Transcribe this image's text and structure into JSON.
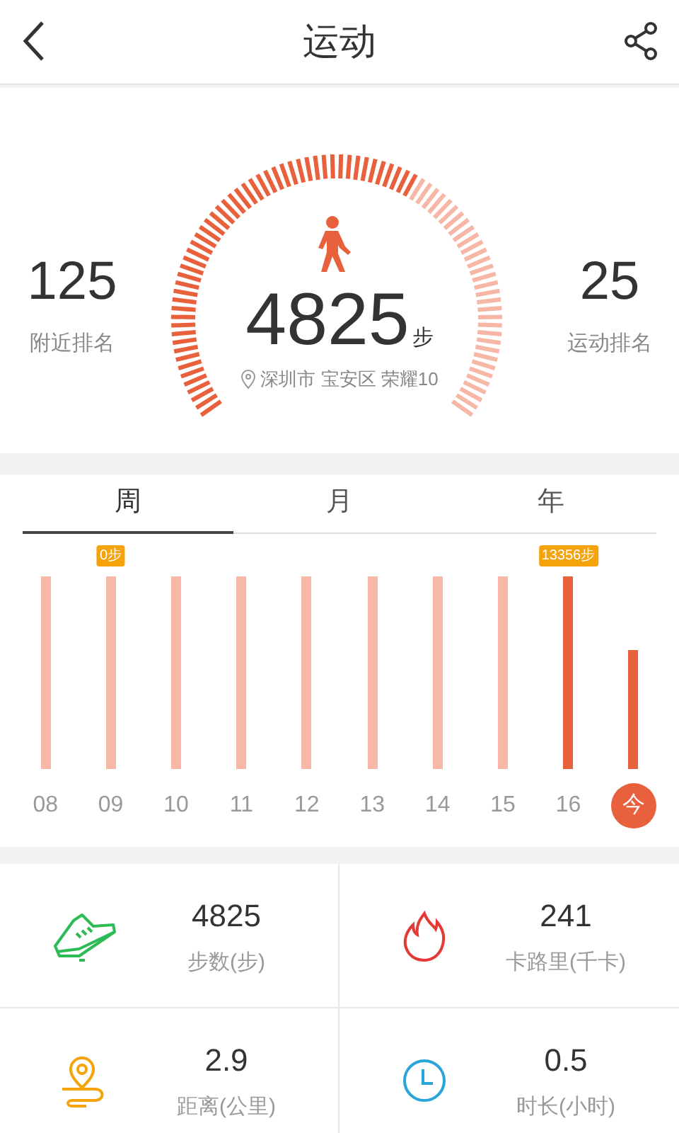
{
  "header": {
    "title": "运动"
  },
  "summary": {
    "nearby": {
      "value": "125",
      "label": "附近排名"
    },
    "sport": {
      "value": "25",
      "label": "运动排名"
    },
    "steps": "4825",
    "unit": "步",
    "location": "深圳市 宝安区 荣耀10"
  },
  "tabs": [
    {
      "label": "周",
      "selected": true
    },
    {
      "label": "月",
      "selected": false
    },
    {
      "label": "年",
      "selected": false
    }
  ],
  "bars": [
    {
      "day": "08",
      "highlighted": false,
      "selected": false
    },
    {
      "day": "09",
      "highlighted": false,
      "selected": false,
      "tooltip": "0步"
    },
    {
      "day": "10",
      "highlighted": false,
      "selected": false
    },
    {
      "day": "11",
      "highlighted": false,
      "selected": false
    },
    {
      "day": "12",
      "highlighted": false,
      "selected": false
    },
    {
      "day": "13",
      "highlighted": false,
      "selected": false
    },
    {
      "day": "14",
      "highlighted": false,
      "selected": false
    },
    {
      "day": "15",
      "highlighted": false,
      "selected": false
    },
    {
      "day": "16",
      "highlighted": true,
      "selected": false,
      "tooltip": "13356步"
    },
    {
      "day": "今",
      "highlighted": true,
      "selected": true
    }
  ],
  "stats": [
    {
      "kind": "shoe",
      "value": "4825",
      "label": "步数(步)"
    },
    {
      "kind": "flame",
      "value": "241",
      "label": "卡路里(千卡)"
    },
    {
      "kind": "route",
      "value": "2.9",
      "label": "距离(公里)"
    },
    {
      "kind": "clock",
      "value": "0.5",
      "label": "时长(小时)"
    }
  ]
}
